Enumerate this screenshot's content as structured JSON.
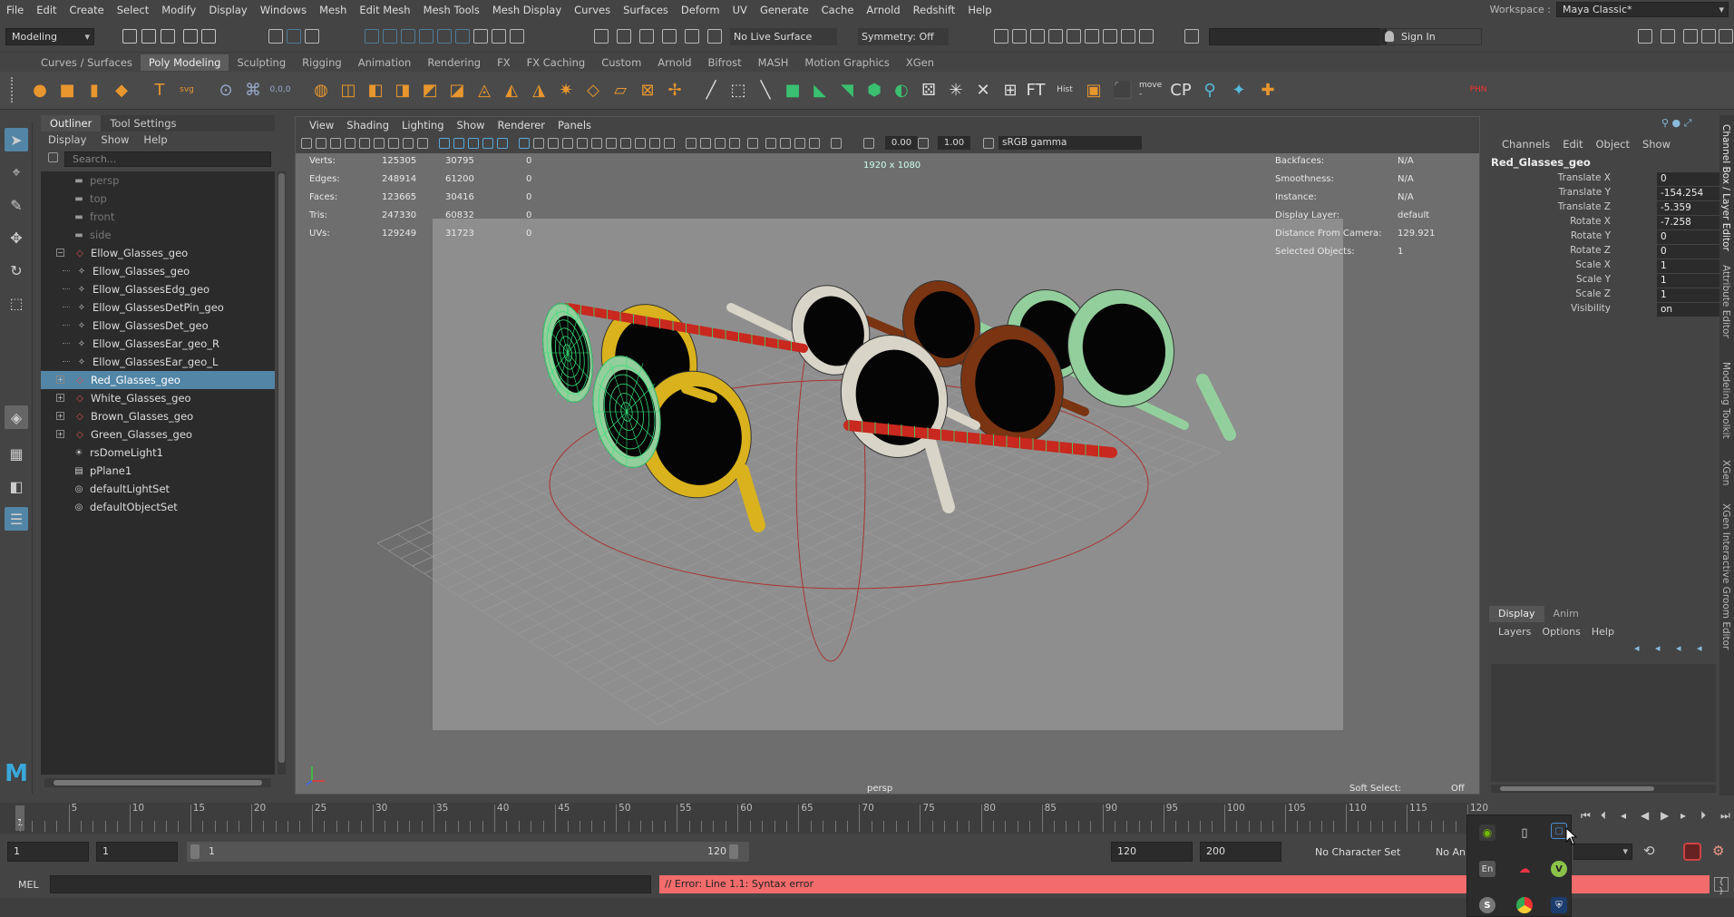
{
  "menubar": {
    "items": [
      "File",
      "Edit",
      "Create",
      "Select",
      "Modify",
      "Display",
      "Windows",
      "Mesh",
      "Edit Mesh",
      "Mesh Tools",
      "Mesh Display",
      "Curves",
      "Surfaces",
      "Deform",
      "UV",
      "Generate",
      "Cache",
      "Arnold",
      "Redshift",
      "Help"
    ],
    "workspace_label": "Workspace :",
    "workspace_value": "Maya Classic*"
  },
  "status": {
    "menuset": "Modeling",
    "live_surface": "No Live Surface",
    "symmetry": "Symmetry: Off",
    "sign_in": "Sign In"
  },
  "shelf": {
    "tabs": [
      "Curves / Surfaces",
      "Poly Modeling",
      "Sculpting",
      "Rigging",
      "Animation",
      "Rendering",
      "FX",
      "FX Caching",
      "Custom",
      "Arnold",
      "Bifrost",
      "MASH",
      "Motion Graphics",
      "XGen"
    ],
    "active_tab": "Poly Modeling",
    "text_icon_labels": {
      "type": "T",
      "svg": "svg",
      "coord": "0,0,0",
      "ft": "FT",
      "hist": "Hist",
      "move": "move -",
      "cp": "CP",
      "phn": "PHN"
    }
  },
  "outliner": {
    "tabs": [
      "Outliner",
      "Tool Settings"
    ],
    "menu": [
      "Display",
      "Show",
      "Help"
    ],
    "search_placeholder": "Search...",
    "nodes": [
      {
        "label": "persp",
        "kind": "camera",
        "dim": true
      },
      {
        "label": "top",
        "kind": "camera",
        "dim": true
      },
      {
        "label": "front",
        "kind": "camera",
        "dim": true
      },
      {
        "label": "side",
        "kind": "camera",
        "dim": true
      },
      {
        "label": "Ellow_Glasses_geo",
        "kind": "group",
        "expanded": true
      },
      {
        "label": "Ellow_Glasses_geo",
        "kind": "mesh",
        "child": true
      },
      {
        "label": "Ellow_GlassesEdg_geo",
        "kind": "mesh",
        "child": true
      },
      {
        "label": "Ellow_GlassesDetPin_geo",
        "kind": "mesh",
        "child": true
      },
      {
        "label": "Ellow_GlassesDet_geo",
        "kind": "mesh",
        "child": true
      },
      {
        "label": "Ellow_GlassesEar_geo_R",
        "kind": "mesh",
        "child": true
      },
      {
        "label": "Ellow_GlassesEar_geo_L",
        "kind": "mesh",
        "child": true
      },
      {
        "label": "Red_Glasses_geo",
        "kind": "group",
        "selected": true
      },
      {
        "label": "White_Glasses_geo",
        "kind": "group"
      },
      {
        "label": "Brown_Glasses_geo",
        "kind": "group"
      },
      {
        "label": "Green_Glasses_geo",
        "kind": "group"
      },
      {
        "label": "rsDomeLight1",
        "kind": "light"
      },
      {
        "label": "pPlane1",
        "kind": "plane"
      },
      {
        "label": "defaultLightSet",
        "kind": "set"
      },
      {
        "label": "defaultObjectSet",
        "kind": "set"
      }
    ]
  },
  "viewport": {
    "menu": [
      "View",
      "Shading",
      "Lighting",
      "Show",
      "Renderer",
      "Panels"
    ],
    "exposure": "0.00",
    "gamma": "1.00",
    "color_space": "sRGB gamma",
    "resolution": "1920 x 1080",
    "camera": "persp",
    "soft_select_label": "Soft Select:",
    "soft_select_value": "Off",
    "stats": [
      {
        "label": "Verts:",
        "a": "125305",
        "b": "30795",
        "c": "0"
      },
      {
        "label": "Edges:",
        "a": "248914",
        "b": "61200",
        "c": "0"
      },
      {
        "label": "Faces:",
        "a": "123665",
        "b": "30416",
        "c": "0"
      },
      {
        "label": "Tris:",
        "a": "247330",
        "b": "60832",
        "c": "0"
      },
      {
        "label": "UVs:",
        "a": "129249",
        "b": "31723",
        "c": "0"
      }
    ],
    "info": [
      {
        "label": "Backfaces:",
        "value": "N/A"
      },
      {
        "label": "Smoothness:",
        "value": "N/A"
      },
      {
        "label": "Instance:",
        "value": "N/A"
      },
      {
        "label": "Display Layer:",
        "value": "default"
      },
      {
        "label": "Distance From Camera:",
        "value": "129.921"
      },
      {
        "label": "Selected Objects:",
        "value": "1"
      }
    ],
    "colors": {
      "yellow": "#d9b21e",
      "white": "#d8d4c8",
      "brown": "#7a3412",
      "green": "#93cf9c",
      "red": "#c8281e",
      "wire": "#35e07a"
    }
  },
  "channel_box": {
    "menu": [
      "Channels",
      "Edit",
      "Object",
      "Show"
    ],
    "object": "Red_Glasses_geo",
    "attrs": [
      {
        "name": "Translate X",
        "value": "0"
      },
      {
        "name": "Translate Y",
        "value": "-154.254"
      },
      {
        "name": "Translate Z",
        "value": "-5.359"
      },
      {
        "name": "Rotate X",
        "value": "-7.258"
      },
      {
        "name": "Rotate Y",
        "value": "0"
      },
      {
        "name": "Rotate Z",
        "value": "0"
      },
      {
        "name": "Scale X",
        "value": "1"
      },
      {
        "name": "Scale Y",
        "value": "1"
      },
      {
        "name": "Scale Z",
        "value": "1"
      },
      {
        "name": "Visibility",
        "value": "on"
      }
    ]
  },
  "layer_editor": {
    "tabs": [
      "Display",
      "Anim"
    ],
    "menu": [
      "Layers",
      "Options",
      "Help"
    ]
  },
  "side_tabs": [
    "Channel Box / Layer Editor",
    "Attribute Editor",
    "Modeling Toolkit",
    "XGen",
    "XGen Interactive Groom Editor"
  ],
  "timeline": {
    "labels": [
      "5",
      "10",
      "15",
      "20",
      "25",
      "30",
      "35",
      "40",
      "45",
      "50",
      "55",
      "60",
      "65",
      "70",
      "75",
      "80",
      "85",
      "90",
      "95",
      "100",
      "105",
      "110",
      "115",
      "120"
    ],
    "current": "1"
  },
  "range": {
    "start": "1",
    "playback_start": "1",
    "slider_start": "1",
    "slider_end": "120",
    "playback_end": "120",
    "end": "200",
    "character_set": "No Character Set",
    "anim_layer": "No An"
  },
  "command": {
    "lang": "MEL",
    "error": "// Error: Line 1.1: Syntax error"
  },
  "tray": {
    "letters": {
      "en": "En",
      "v": "V",
      "s": "S"
    }
  }
}
